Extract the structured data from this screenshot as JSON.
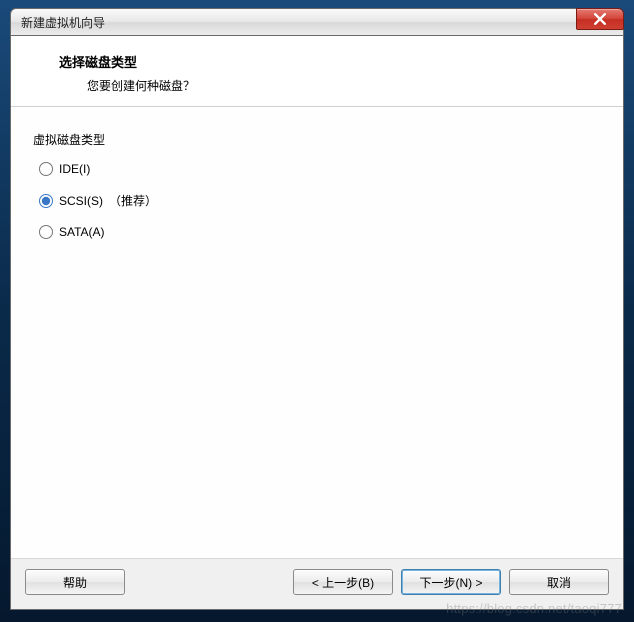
{
  "window": {
    "title": "新建虚拟机向导"
  },
  "header": {
    "title": "选择磁盘类型",
    "subtitle": "您要创建何种磁盘？"
  },
  "group": {
    "label": "虚拟磁盘类型"
  },
  "options": {
    "ide": {
      "label": "IDE(I)"
    },
    "scsi": {
      "label": "SCSI(S)",
      "recommended": "（推荐）"
    },
    "sata": {
      "label": "SATA(A)"
    }
  },
  "buttons": {
    "help": "帮助",
    "back": "< 上一步(B)",
    "next": "下一步(N) >",
    "cancel": "取消"
  },
  "watermark": "https://blog.csdn.net/taoqi777"
}
